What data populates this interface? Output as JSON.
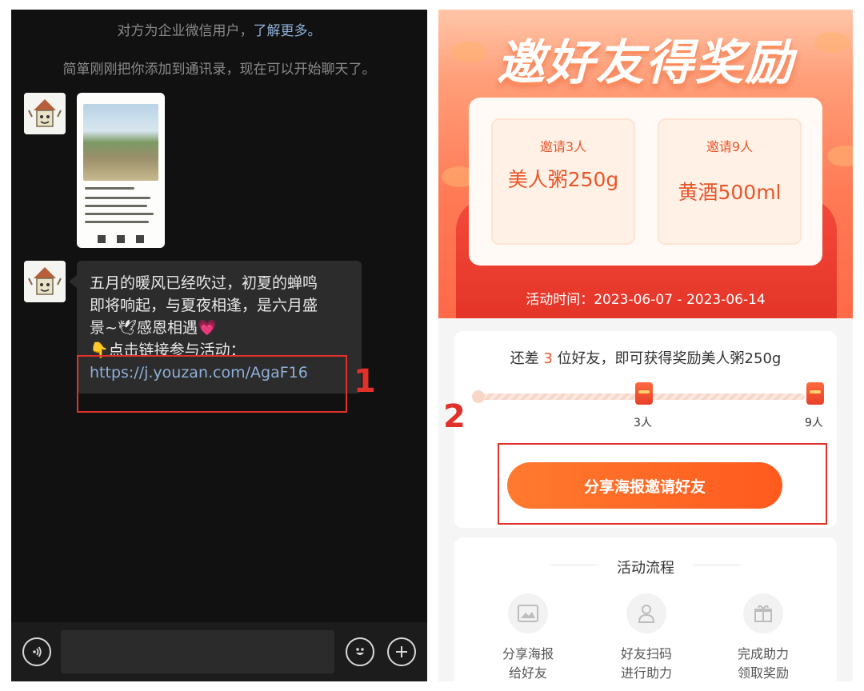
{
  "chat": {
    "system_notice": "对方为企业微信用户，",
    "system_notice_link": "了解更多。",
    "system_added": "简箪刚刚把你添加到通讯录，现在可以开始聊天了。",
    "message_line1": "五月的暖风已经吹过，初夏的蝉鸣",
    "message_line2": "即将响起，与夏夜相逢，是六月盛",
    "message_line3": "景~🕊感恩相遇💗",
    "message_line4": "👇点击链接参与活动：",
    "message_url": "https://j.youzan.com/AgaF16",
    "callout_number": "1",
    "voice_icon": "voice-icon",
    "emoji_icon": "emoji-icon",
    "plus_icon": "plus-icon"
  },
  "promo": {
    "hero_title": "邀好友得奖励",
    "rewards": [
      {
        "condition": "邀请3人",
        "prize": "美人粥250g"
      },
      {
        "condition": "邀请9人",
        "prize": "黄酒500ml"
      }
    ],
    "activity_time": "活动时间：2023-06-07 - 2023-06-14",
    "progress_prefix": "还差 ",
    "progress_count": "3",
    "progress_suffix": " 位好友，即可获得奖励美人粥250g",
    "milestones": [
      "3人",
      "9人"
    ],
    "share_button": "分享海报邀请好友",
    "callout_number": "2",
    "flow_title": "活动流程",
    "flow_steps": [
      {
        "line1": "分享海报",
        "line2": "给好友",
        "icon": "image-icon"
      },
      {
        "line1": "好友扫码",
        "line2": "进行助力",
        "icon": "user-icon"
      },
      {
        "line1": "完成助力",
        "line2": "领取奖励",
        "icon": "gift-icon"
      }
    ],
    "colors": {
      "accent": "#ff5a1e",
      "highlight": "#e8562a",
      "callout": "#e0322a"
    }
  }
}
